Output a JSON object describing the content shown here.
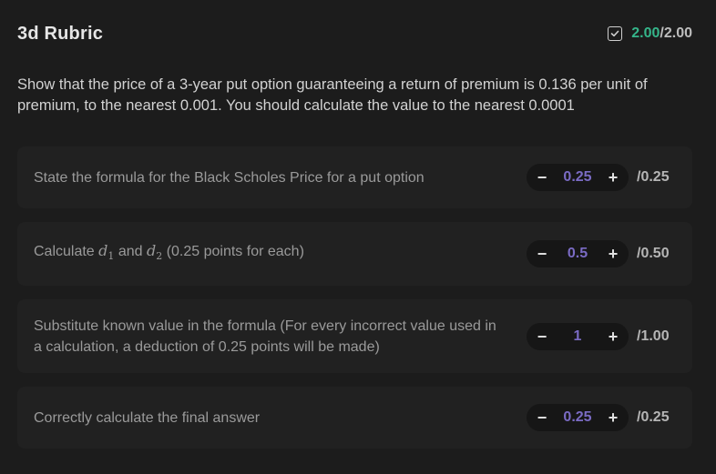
{
  "header": {
    "title": "3d Rubric",
    "score_earned": "2.00",
    "score_max": "/2.00",
    "icon": "checkbox-check-icon"
  },
  "question": "Show that the price of a 3-year put option guaranteeing a return of premium is 0.136 per unit of premium, to the nearest 0.001. You should calculate the value to the nearest 0.0001",
  "criteria": [
    {
      "label": "State the formula for the Black Scholes Price for a put option",
      "value": "0.25",
      "max": "/0.25",
      "minus": "−",
      "plus": "+"
    },
    {
      "label_pre": "Calculate ",
      "math1": "d",
      "math1_sub": "1",
      "label_mid": " and ",
      "math2": "d",
      "math2_sub": "2",
      "label_post": " (0.25 points for each)",
      "value": "0.5",
      "max": "/0.50",
      "minus": "−",
      "plus": "+"
    },
    {
      "label": "Substitute known value in the formula (For every incorrect value used in a calculation, a deduction of 0.25 points will be made)",
      "value": "1",
      "max": "/1.00",
      "minus": "−",
      "plus": "+"
    },
    {
      "label": "Correctly calculate the final answer",
      "value": "0.25",
      "max": "/0.25",
      "minus": "−",
      "plus": "+"
    }
  ],
  "colors": {
    "background": "#1c1c1c",
    "card": "#212121",
    "earned": "#35b58a",
    "value": "#7a6bc4"
  }
}
